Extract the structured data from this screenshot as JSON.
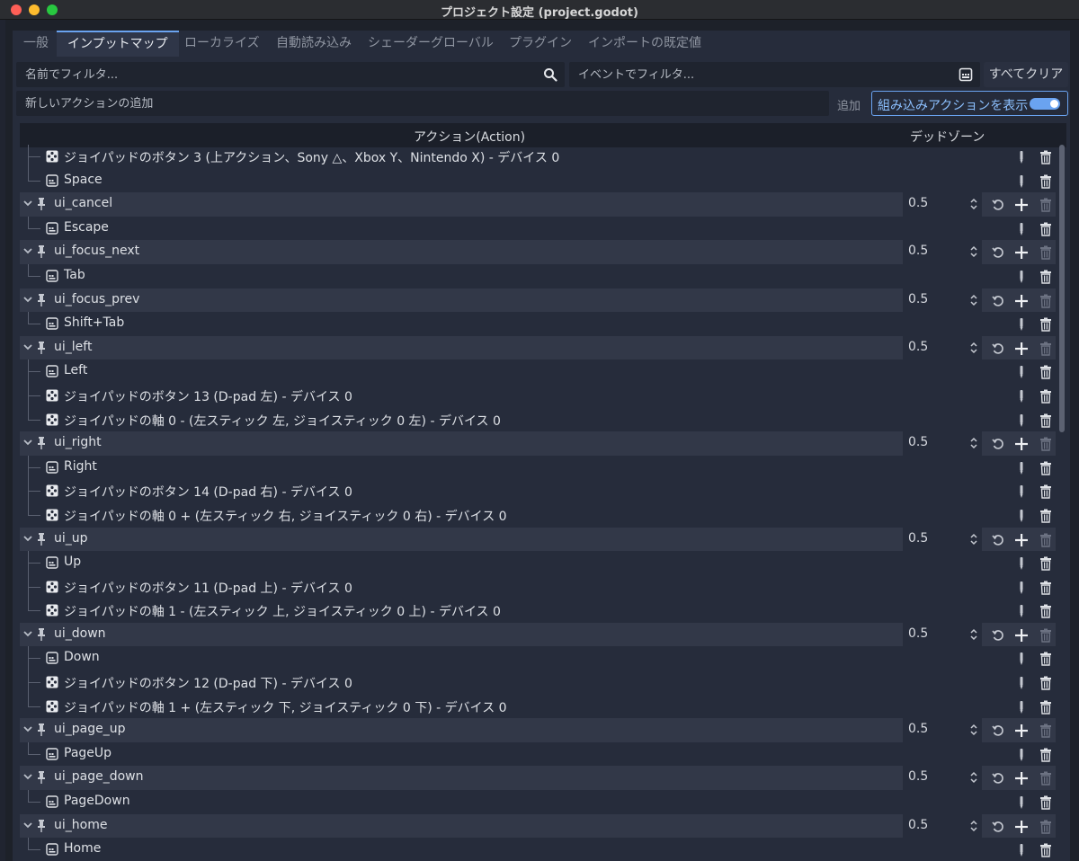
{
  "window": {
    "title": "プロジェクト設定 (project.godot)"
  },
  "tabs": [
    {
      "label": "一般",
      "active": false
    },
    {
      "label": "インプットマップ",
      "active": true
    },
    {
      "label": "ローカライズ",
      "active": false
    },
    {
      "label": "自動読み込み",
      "active": false
    },
    {
      "label": "シェーダーグローバル",
      "active": false
    },
    {
      "label": "プラグイン",
      "active": false
    },
    {
      "label": "インポートの既定値",
      "active": false
    }
  ],
  "toolbar": {
    "name_filter_placeholder": "名前でフィルタ...",
    "event_filter_placeholder": "イベントでフィルタ...",
    "clear_all_label": "すべてクリア",
    "new_action_placeholder": "新しいアクションの追加",
    "add_label": "追加",
    "show_builtin_label": "組み込みアクションを表示",
    "show_builtin_on": true
  },
  "table": {
    "col_action": "アクション(Action)",
    "col_deadzone": "デッドゾーン"
  },
  "rows": [
    {
      "type": "event",
      "icon": "joypad-icon",
      "text": "ジョイパッドのボタン 3 (上アクション、Sony △、Xbox Y、Nintendo X) - デバイス 0"
    },
    {
      "type": "event",
      "icon": "keyboard-icon",
      "text": "Space"
    },
    {
      "type": "action",
      "text": "ui_cancel",
      "deadzone": "0.5"
    },
    {
      "type": "event",
      "icon": "keyboard-icon",
      "text": "Escape"
    },
    {
      "type": "action",
      "text": "ui_focus_next",
      "deadzone": "0.5"
    },
    {
      "type": "event",
      "icon": "keyboard-icon",
      "text": "Tab"
    },
    {
      "type": "action",
      "text": "ui_focus_prev",
      "deadzone": "0.5"
    },
    {
      "type": "event",
      "icon": "keyboard-icon",
      "text": "Shift+Tab"
    },
    {
      "type": "action",
      "text": "ui_left",
      "deadzone": "0.5"
    },
    {
      "type": "event",
      "icon": "keyboard-icon",
      "text": "Left"
    },
    {
      "type": "event",
      "icon": "joypad-icon",
      "text": "ジョイパッドのボタン 13 (D-pad 左) - デバイス 0"
    },
    {
      "type": "event",
      "icon": "joypad-icon",
      "text": "ジョイパッドの軸 0 - (左スティック 左, ジョイスティック 0 左) - デバイス 0"
    },
    {
      "type": "action",
      "text": "ui_right",
      "deadzone": "0.5"
    },
    {
      "type": "event",
      "icon": "keyboard-icon",
      "text": "Right"
    },
    {
      "type": "event",
      "icon": "joypad-icon",
      "text": "ジョイパッドのボタン 14 (D-pad 右) - デバイス 0"
    },
    {
      "type": "event",
      "icon": "joypad-icon",
      "text": "ジョイパッドの軸 0 + (左スティック 右, ジョイスティック 0 右) - デバイス 0"
    },
    {
      "type": "action",
      "text": "ui_up",
      "deadzone": "0.5"
    },
    {
      "type": "event",
      "icon": "keyboard-icon",
      "text": "Up"
    },
    {
      "type": "event",
      "icon": "joypad-icon",
      "text": "ジョイパッドのボタン 11 (D-pad 上) - デバイス 0"
    },
    {
      "type": "event",
      "icon": "joypad-icon",
      "text": "ジョイパッドの軸 1 - (左スティック 上, ジョイスティック 0 上) - デバイス 0"
    },
    {
      "type": "action",
      "text": "ui_down",
      "deadzone": "0.5"
    },
    {
      "type": "event",
      "icon": "keyboard-icon",
      "text": "Down"
    },
    {
      "type": "event",
      "icon": "joypad-icon",
      "text": "ジョイパッドのボタン 12 (D-pad 下) - デバイス 0"
    },
    {
      "type": "event",
      "icon": "joypad-icon",
      "text": "ジョイパッドの軸 1 + (左スティック 下, ジョイスティック 0 下) - デバイス 0"
    },
    {
      "type": "action",
      "text": "ui_page_up",
      "deadzone": "0.5"
    },
    {
      "type": "event",
      "icon": "keyboard-icon",
      "text": "PageUp"
    },
    {
      "type": "action",
      "text": "ui_page_down",
      "deadzone": "0.5"
    },
    {
      "type": "event",
      "icon": "keyboard-icon",
      "text": "PageDown"
    },
    {
      "type": "action",
      "text": "ui_home",
      "deadzone": "0.5"
    },
    {
      "type": "event",
      "icon": "keyboard-icon",
      "text": "Home"
    }
  ],
  "colors": {
    "accent": "#6aa3f0",
    "panel": "#262c3b",
    "action_row": "#323848",
    "field": "#1f242f"
  }
}
